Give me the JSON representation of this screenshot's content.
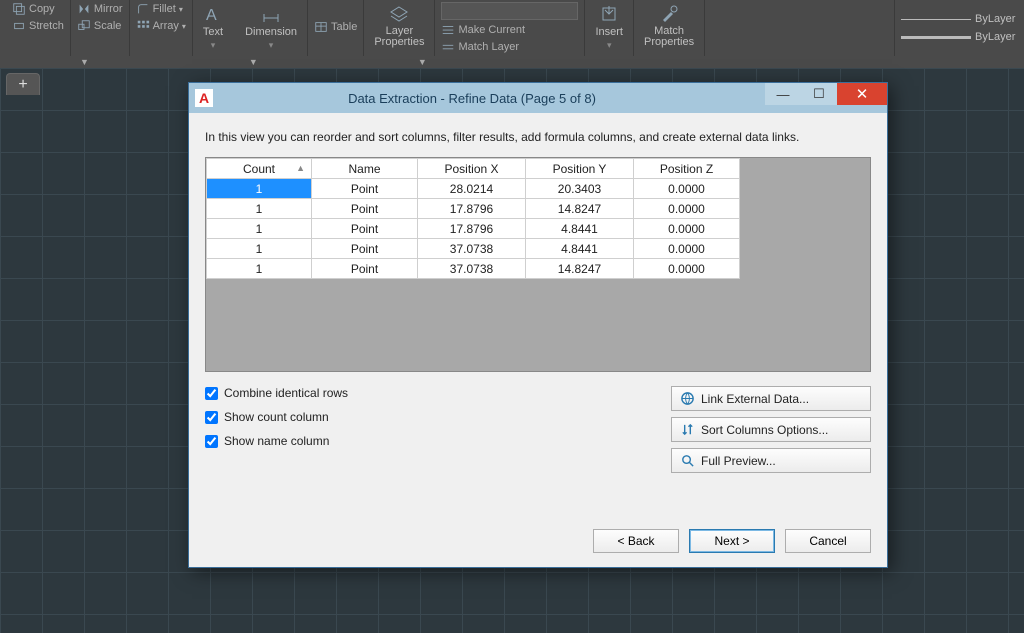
{
  "ribbon": {
    "copy": "Copy",
    "stretch": "Stretch",
    "mirror": "Mirror",
    "scale": "Scale",
    "fillet": "Fillet",
    "array": "Array",
    "text": "Text",
    "dimension": "Dimension",
    "table": "Table",
    "layer_props": "Layer\nProperties",
    "make_current": "Make Current",
    "match_layer": "Match Layer",
    "insert": "Insert",
    "match_props": "Match\nProperties",
    "bylayer": "ByLayer"
  },
  "dialog": {
    "title": "Data Extraction - Refine Data (Page 5 of 8)",
    "description": "In this view you can reorder and sort columns, filter results, add formula columns, and create external data links.",
    "columns": [
      "Count",
      "Name",
      "Position X",
      "Position Y",
      "Position Z"
    ],
    "rows": [
      {
        "count": "1",
        "name": "Point",
        "px": "28.0214",
        "py": "20.3403",
        "pz": "0.0000"
      },
      {
        "count": "1",
        "name": "Point",
        "px": "17.8796",
        "py": "14.8247",
        "pz": "0.0000"
      },
      {
        "count": "1",
        "name": "Point",
        "px": "17.8796",
        "py": "4.8441",
        "pz": "0.0000"
      },
      {
        "count": "1",
        "name": "Point",
        "px": "37.0738",
        "py": "4.8441",
        "pz": "0.0000"
      },
      {
        "count": "1",
        "name": "Point",
        "px": "37.0738",
        "py": "14.8247",
        "pz": "0.0000"
      }
    ],
    "checkboxes": {
      "combine": "Combine identical rows",
      "show_count": "Show count column",
      "show_name": "Show name column"
    },
    "side_buttons": {
      "link": "Link External Data...",
      "sort": "Sort Columns Options...",
      "preview": "Full Preview..."
    },
    "nav": {
      "back": "< Back",
      "next": "Next >",
      "cancel": "Cancel"
    }
  }
}
